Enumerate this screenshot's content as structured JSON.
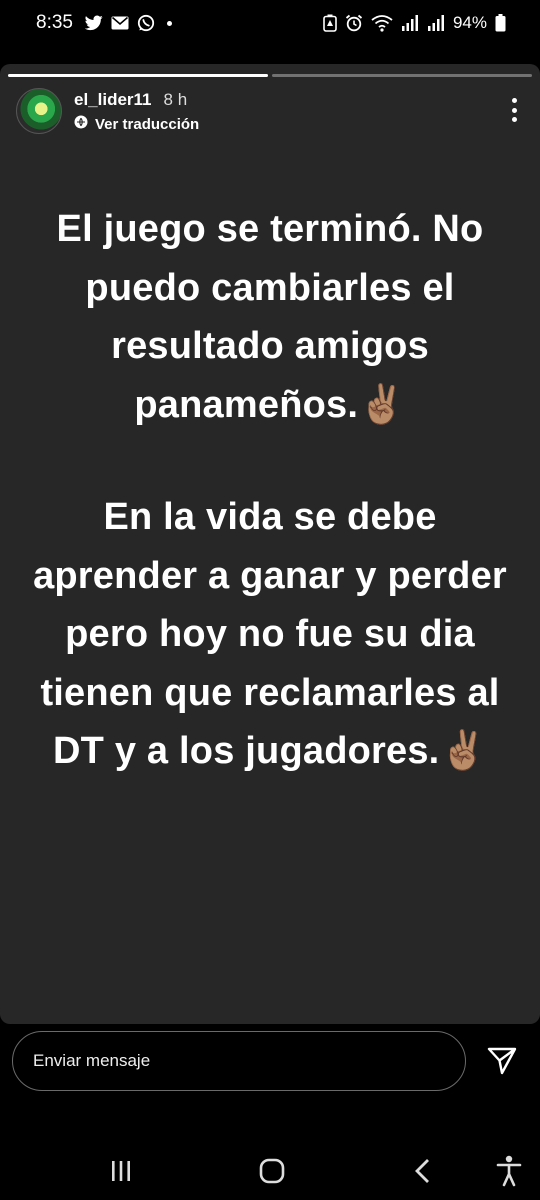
{
  "status_bar": {
    "time": "8:35",
    "battery": "94%",
    "left_icons": [
      "twitter-icon",
      "gmail-icon",
      "whatsapp-icon",
      "notification-dot"
    ],
    "right_icons": [
      "battery-saver-icon",
      "alarm-icon",
      "wifi-icon",
      "signal-icon",
      "signal-icon",
      "battery-icon"
    ]
  },
  "story": {
    "progress": [
      1,
      0
    ],
    "username": "el_lider11",
    "time_ago": "8 h",
    "translate_label": "Ver traducción",
    "paragraph1": "El juego se terminó. No puedo cambiarles el resultado amigos panameños.✌🏽",
    "paragraph2": "En la vida se debe aprender a ganar y perder pero hoy no fue su dia tienen que reclamarles al DT y a los jugadores.✌🏽"
  },
  "reply": {
    "placeholder": "Enviar mensaje"
  },
  "colors": {
    "story_bg": "#272727",
    "page_bg": "#000000",
    "text": "#ffffff"
  }
}
